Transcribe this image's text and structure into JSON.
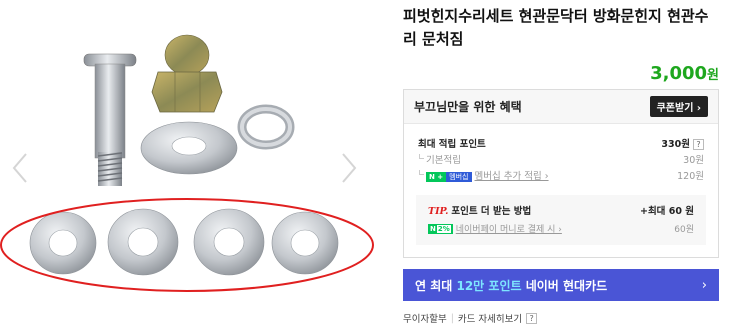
{
  "product": {
    "title_line1": "피벗힌지수리세트 현관문닥터 방화문힌지 현관수",
    "title_line2": "리 문처짐",
    "price": "3,000",
    "currency": "원"
  },
  "benefits": {
    "header": "부끄님만을 위한 혜택",
    "coupon_button": "쿠폰받기 ›",
    "max_points_label": "최대 적립 포인트",
    "max_points_value": "330원",
    "help_mark": "?",
    "basic_label": "기본적립",
    "basic_value": "30원",
    "np_badge": "N +",
    "membership_badge": "멤버십",
    "membership_label": "멤버십 추가 적립 ›",
    "membership_value": "120원",
    "tip_word": "TIP.",
    "tip_title": "포인트 더 받는 방법",
    "tip_max": "+최대 60 원",
    "pct_badge_n": "N",
    "pct_badge_pct": "2%",
    "tip_link": "네이버페이 머니로 결제 시 ›",
    "tip_value": "60원"
  },
  "card_banner": {
    "prefix": "연 최대 ",
    "highlight": "12만 포인트",
    "suffix": " 네이버 현대카드",
    "arrow": "›"
  },
  "footer": {
    "installment": "무이자할부",
    "separator": "|",
    "card_details": "카드 자세히보기",
    "help_mark": "?"
  },
  "icons": {
    "prev": "chevron-left-icon",
    "next": "chevron-right-icon"
  },
  "colors": {
    "price_green": "#1ea71e",
    "naver_green": "#03c75a",
    "card_blue": "#4a55d6",
    "tip_red": "#e01e1e",
    "annotation_red": "#e02020"
  }
}
